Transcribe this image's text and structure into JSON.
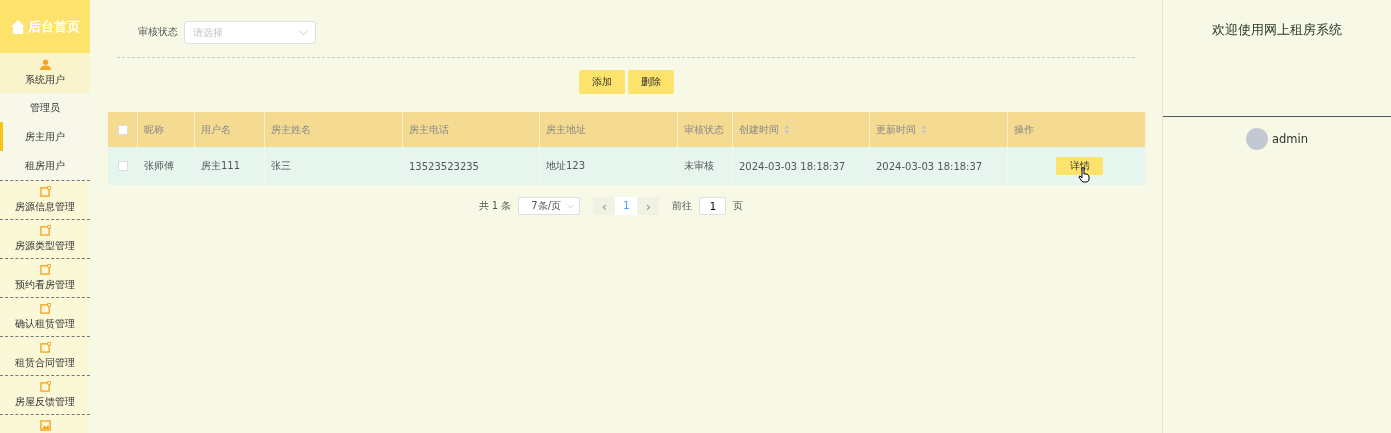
{
  "sidebar": {
    "home": "后台首页",
    "groups": [
      {
        "label": "系统用户",
        "kind": "group",
        "children": [
          {
            "label": "管理员",
            "selected": false
          },
          {
            "label": "房主用户",
            "selected": true
          },
          {
            "label": "租房用户",
            "selected": false
          }
        ]
      },
      {
        "label": "房源信息管理",
        "kind": "item"
      },
      {
        "label": "房源类型管理",
        "kind": "item"
      },
      {
        "label": "预约看房管理",
        "kind": "item"
      },
      {
        "label": "确认租赁管理",
        "kind": "item"
      },
      {
        "label": "租赁合同管理",
        "kind": "item"
      },
      {
        "label": "房屋反馈管理",
        "kind": "item"
      }
    ]
  },
  "filter": {
    "label": "审核状态",
    "placeholder": "请选择"
  },
  "actions": [
    "添加",
    "删除"
  ],
  "table": {
    "select_all": false,
    "columns": [
      {
        "label": "昵称",
        "sortable": false
      },
      {
        "label": "用户名",
        "sortable": false
      },
      {
        "label": "房主姓名",
        "sortable": false
      },
      {
        "label": "房主电话",
        "sortable": false
      },
      {
        "label": "房主地址",
        "sortable": false
      },
      {
        "label": "审核状态",
        "sortable": false
      },
      {
        "label": "创建时间",
        "sortable": true
      },
      {
        "label": "更新时间",
        "sortable": true
      },
      {
        "label": "操作",
        "sortable": false
      }
    ],
    "rows": [
      {
        "checked": false,
        "cells": [
          "张师傅",
          "房主111",
          "张三",
          "13523523235",
          "地址123",
          "未审核",
          "2024-03-03 18:18:37",
          "2024-03-03 18:18:37"
        ],
        "action": "详情"
      }
    ]
  },
  "pagination": {
    "total": "共 1 条",
    "page_size": "7条/页",
    "prev": "‹",
    "page": "1",
    "next": "›",
    "goto_label": "前往",
    "goto_value": "1",
    "goto_suffix": "页"
  },
  "right_panel": {
    "welcome": "欢迎使用网上租房系统",
    "user": "admin"
  }
}
